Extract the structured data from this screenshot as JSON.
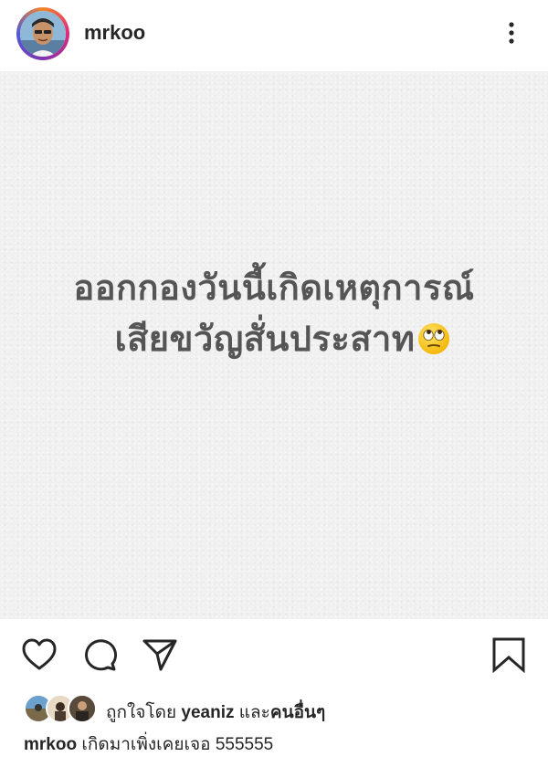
{
  "header": {
    "username": "mrkoo",
    "avatar_icon": "profile-avatar",
    "more_icon": "more-vertical-icon"
  },
  "post": {
    "line1": "ออกกองวันนี้เกิดเหตุการณ์",
    "line2": "เสียขวัญสั่นประสาท",
    "emoji": "face-with-rolling-eyes-emoji"
  },
  "actions": {
    "like_icon": "heart-icon",
    "comment_icon": "comment-icon",
    "share_icon": "send-icon",
    "save_icon": "bookmark-icon"
  },
  "likes": {
    "prefix": "ถูกใจโดย",
    "user": "yeaniz",
    "conjunction": "และ",
    "others": "คนอื่นๆ"
  },
  "caption": {
    "username": "mrkoo",
    "text": "เกิดมาเพิ่งเคยเจอ 555555"
  },
  "colors": {
    "text": "#262626",
    "post_text": "#555555",
    "post_background": "#f0f0f0"
  }
}
